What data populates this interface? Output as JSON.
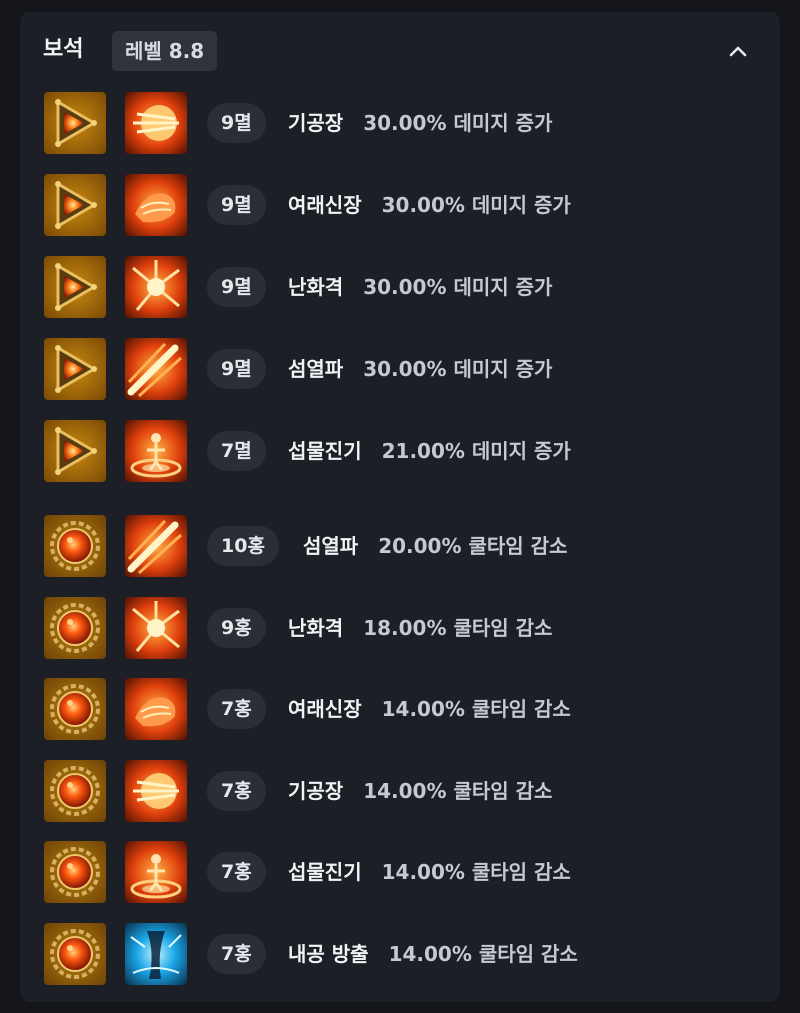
{
  "header": {
    "title": "보석",
    "level_label": "레벨 8.8",
    "collapse_icon": "chevron-up-icon"
  },
  "gems": [
    {
      "gem_type": "annihilation",
      "tier": "9멸",
      "skill": "기공장",
      "effect": "30.00% 데미지 증가",
      "skill_icon": "ki-palm-icon"
    },
    {
      "gem_type": "annihilation",
      "tier": "9멸",
      "skill": "여래신장",
      "effect": "30.00% 데미지 증가",
      "skill_icon": "buddha-palm-icon"
    },
    {
      "gem_type": "annihilation",
      "tier": "9멸",
      "skill": "난화격",
      "effect": "30.00% 데미지 증가",
      "skill_icon": "flower-strike-icon"
    },
    {
      "gem_type": "annihilation",
      "tier": "9멸",
      "skill": "섬열파",
      "effect": "30.00% 데미지 증가",
      "skill_icon": "flash-wave-icon"
    },
    {
      "gem_type": "annihilation",
      "tier": "7멸",
      "skill": "섭물진기",
      "effect": "21.00% 데미지 증가",
      "skill_icon": "qi-pull-icon"
    },
    {
      "gem_type": "crimson",
      "tier": "10홍",
      "skill": "섬열파",
      "effect": "20.00% 쿨타임 감소",
      "skill_icon": "flash-wave-icon"
    },
    {
      "gem_type": "crimson",
      "tier": "9홍",
      "skill": "난화격",
      "effect": "18.00% 쿨타임 감소",
      "skill_icon": "flower-strike-icon"
    },
    {
      "gem_type": "crimson",
      "tier": "7홍",
      "skill": "여래신장",
      "effect": "14.00% 쿨타임 감소",
      "skill_icon": "buddha-palm-icon"
    },
    {
      "gem_type": "crimson",
      "tier": "7홍",
      "skill": "기공장",
      "effect": "14.00% 쿨타임 감소",
      "skill_icon": "ki-palm-icon"
    },
    {
      "gem_type": "crimson",
      "tier": "7홍",
      "skill": "섭물진기",
      "effect": "14.00% 쿨타임 감소",
      "skill_icon": "qi-pull-icon"
    },
    {
      "gem_type": "crimson",
      "tier": "7홍",
      "skill": "내공 방출",
      "effect": "14.00% 쿨타임 감소",
      "skill_icon": "inner-energy-release-icon"
    }
  ],
  "colors": {
    "panel_bg": "#1c1f26",
    "page_bg": "#13151a",
    "badge_bg": "#2a2e36",
    "gem_gold": "#b0780a",
    "fire_orange": "#ff6a10"
  }
}
